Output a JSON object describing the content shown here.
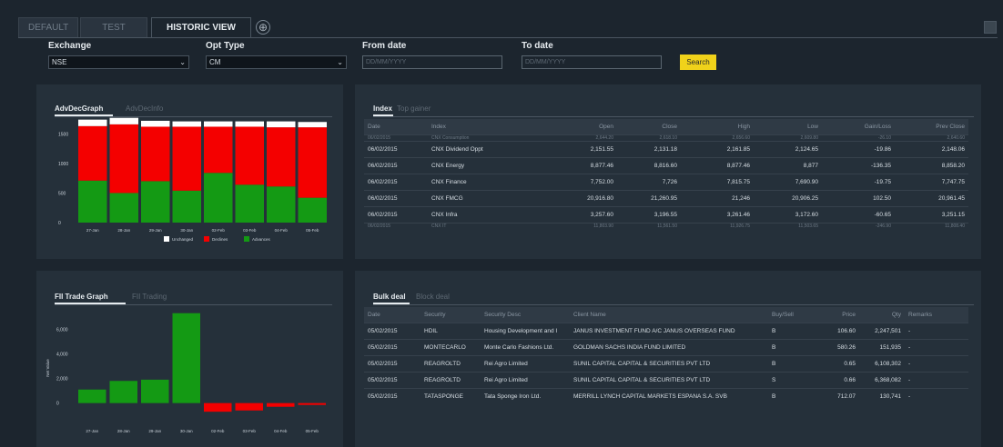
{
  "tabs": [
    {
      "label": "DEFAULT"
    },
    {
      "label": "TEST"
    },
    {
      "label": "HISTORIC VIEW"
    }
  ],
  "add_tab_glyph": "⊕",
  "filters": {
    "exchange_label": "Exchange",
    "exchange_value": "NSE",
    "opt_type_label": "Opt Type",
    "opt_type_value": "CM",
    "from_date_label": "From date",
    "from_date_placeholder": "DD/MM/YYYY",
    "to_date_label": "To date",
    "to_date_placeholder": "DD/MM/YYYY",
    "search_label": "Search"
  },
  "adv_panel": {
    "tab_active": "AdvDecGraph",
    "tab_inactive": "AdvDecInfo"
  },
  "fii_panel": {
    "tab_active": "FII Trade Graph",
    "tab_inactive": "FII Trading"
  },
  "index_panel": {
    "tab_active": "Index",
    "tab_inactive": "Top gainer",
    "columns": [
      "Date",
      "Index",
      "Open",
      "Close",
      "High",
      "Low",
      "Gain/Loss",
      "Prev Close"
    ],
    "top_clip": [
      "06/02/2015",
      "CNX Consumption",
      "2,644.20",
      "2,618.10",
      "2,656.60",
      "2,609.80",
      "-26.10",
      "2,640.60"
    ],
    "rows": [
      [
        "06/02/2015",
        "CNX Dividend Oppt",
        "2,151.55",
        "2,131.18",
        "2,161.85",
        "2,124.65",
        "-19.86",
        "2,148.06"
      ],
      [
        "06/02/2015",
        "CNX Energy",
        "8,877.46",
        "8,816.60",
        "8,877.46",
        "8,877",
        "-136.35",
        "8,858.20"
      ],
      [
        "06/02/2015",
        "CNX Finance",
        "7,752.00",
        "7,726",
        "7,815.75",
        "7,690.90",
        "-19.75",
        "7,747.75"
      ],
      [
        "06/02/2015",
        "CNX FMCG",
        "20,916.80",
        "21,260.95",
        "21,246",
        "20,906.25",
        "102.50",
        "20,961.45"
      ],
      [
        "06/02/2015",
        "CNX Infra",
        "3,257.60",
        "3,196.55",
        "3,261.46",
        "3,172.60",
        "-60.65",
        "3,251.15"
      ]
    ],
    "bottom_clip": [
      "06/02/2015",
      "CNX IT",
      "11,803.90",
      "11,561.50",
      "11,926.75",
      "11,503.65",
      "-246.90",
      "11,808.40"
    ]
  },
  "bulk_panel": {
    "tab_active": "Bulk deal",
    "tab_inactive": "Block deal",
    "columns": [
      "Date",
      "Security",
      "Security Desc",
      "Client Name",
      "Buy/Sell",
      "Price",
      "Qty",
      "Remarks"
    ],
    "rows": [
      [
        "05/02/2015",
        "HDIL",
        "Housing Development and I",
        "JANUS INVESTMENT FUND A/C JANUS OVERSEAS FUND",
        "B",
        "106.60",
        "2,247,501",
        "-"
      ],
      [
        "05/02/2015",
        "MONTECARLO",
        "Monte Carlo Fashions Ltd.",
        "GOLDMAN SACHS INDIA FUND LIMITED",
        "B",
        "580.26",
        "151,935",
        "-"
      ],
      [
        "05/02/2015",
        "REAGROLTD",
        "Rei Agro Limited",
        "SUNIL CAPITAL CAPITAL & SECURITIES PVT LTD",
        "B",
        "0.65",
        "6,108,302",
        "-"
      ],
      [
        "05/02/2015",
        "REAGROLTD",
        "Rei Agro Limited",
        "SUNIL CAPITAL CAPITAL & SECURITIES PVT LTD",
        "S",
        "0.66",
        "6,368,082",
        "-"
      ],
      [
        "05/02/2015",
        "TATASPONGE",
        "Tata Sponge Iron Ltd.",
        "MERRILL LYNCH CAPITAL MARKETS ESPANA S.A. SVB",
        "B",
        "712.07",
        "130,741",
        "-"
      ]
    ]
  },
  "chart_data": [
    {
      "type": "bar",
      "stacked": true,
      "categories": [
        "27-Jan",
        "28-Jan",
        "29-Jan",
        "30-Jan",
        "02-Feb",
        "03-Feb",
        "04-Feb",
        "05-Feb"
      ],
      "series": [
        {
          "name": "Advances",
          "color": "#149a14",
          "values": [
            710,
            500,
            700,
            540,
            840,
            640,
            610,
            420
          ]
        },
        {
          "name": "Declines",
          "color": "#f40000",
          "values": [
            920,
            1160,
            920,
            1080,
            780,
            980,
            1000,
            1190
          ]
        },
        {
          "name": "Unchanged",
          "color": "#ffffff",
          "values": [
            110,
            110,
            100,
            90,
            90,
            90,
            100,
            90
          ]
        }
      ],
      "yticks": [
        "0",
        "500",
        "1000",
        "1500"
      ],
      "ylim": [
        0,
        1750
      ],
      "legend_position": "bottom"
    },
    {
      "type": "bar",
      "categories": [
        "27-Jan",
        "28-Jan",
        "29-Jan",
        "30-Jan",
        "02-Feb",
        "03-Feb",
        "04-Feb",
        "05-Feb"
      ],
      "values": [
        1100,
        1800,
        1900,
        7300,
        -700,
        -600,
        -300,
        -150
      ],
      "positive_color": "#149a14",
      "negative_color": "#f40000",
      "yticks": [
        "0",
        "2,000",
        "4,000",
        "6,000"
      ],
      "ylabel": "Net Value",
      "ylim": [
        -1500,
        7500
      ]
    }
  ]
}
